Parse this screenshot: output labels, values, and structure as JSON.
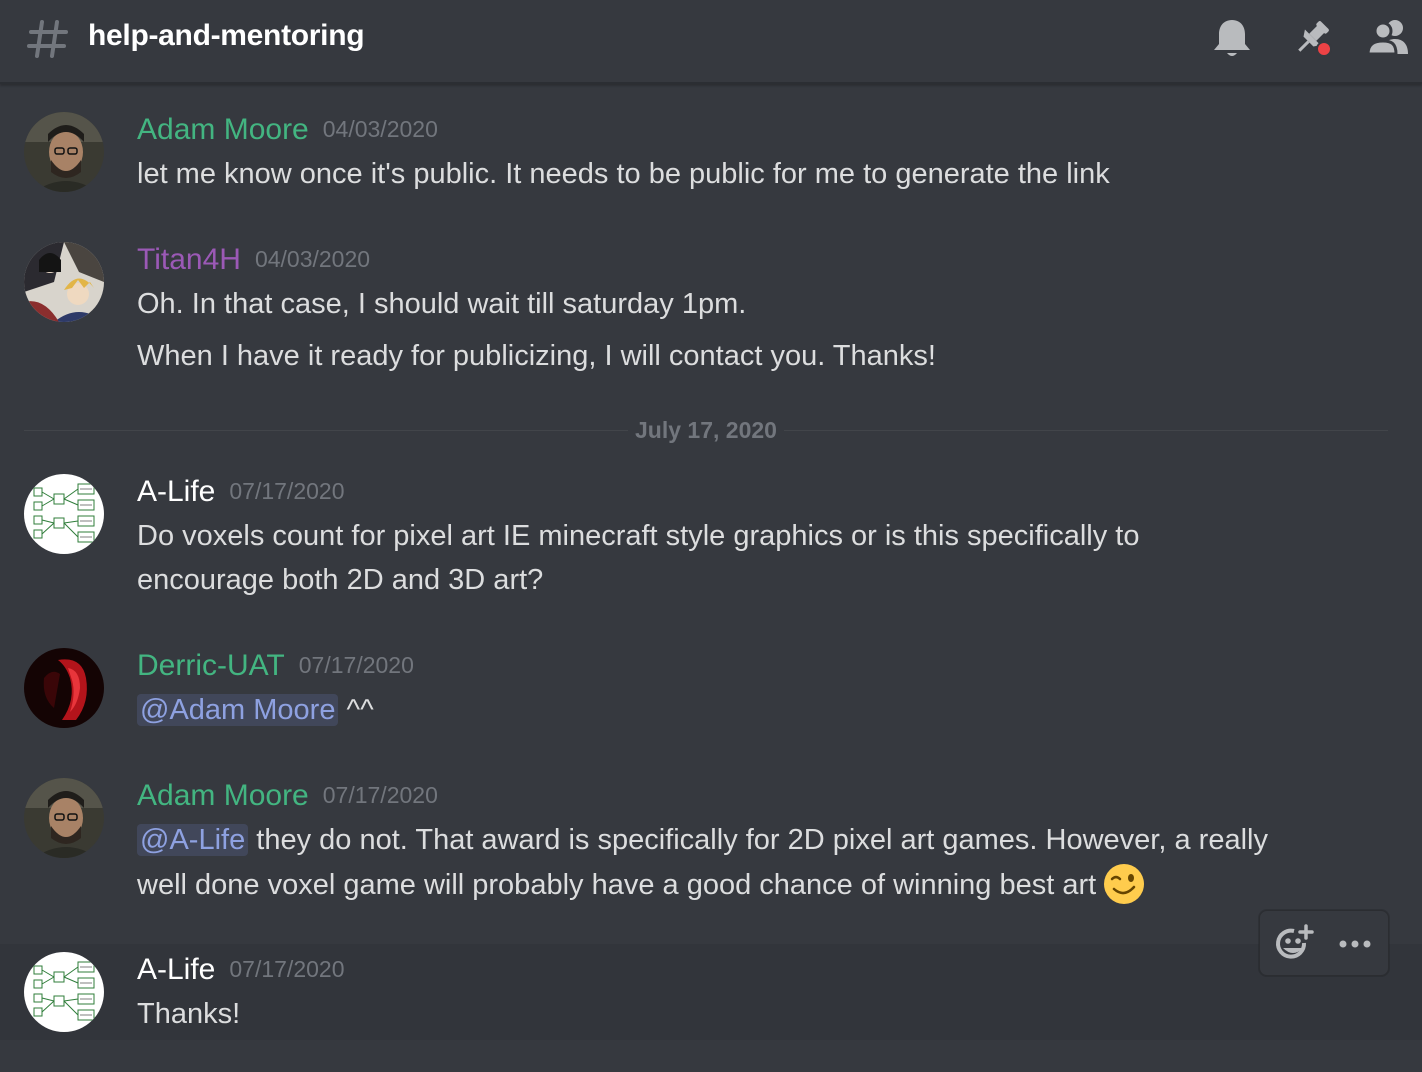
{
  "header": {
    "channel_name": "help-and-mentoring",
    "icons": [
      "hash-icon",
      "bell-icon",
      "pin-icon",
      "members-icon"
    ],
    "pin_notification_color": "#ed4245"
  },
  "colors": {
    "background": "#36393f",
    "adam_moore": "#43b581",
    "titan4h": "#9b59b6",
    "a_life": "#ffffff",
    "derric_uat": "#43b581",
    "mention": "#8ea1e1",
    "timestamp": "#72767d"
  },
  "messages": [
    {
      "author": "Adam Moore",
      "timestamp": "04/03/2020",
      "lines": [
        "let me know once it's public. It needs to be public for me to generate the link"
      ]
    },
    {
      "author": "Titan4H",
      "timestamp": "04/03/2020",
      "lines": [
        "Oh. In that case, I should wait till saturday 1pm.",
        "When I have it ready for publicizing, I will contact you. Thanks!"
      ]
    },
    {
      "author": "A-Life",
      "timestamp": "07/17/2020",
      "lines": [
        "Do voxels count for pixel art IE minecraft style graphics or is this specifically to",
        "encourage both 2D and 3D art?"
      ]
    },
    {
      "author": "Derric-UAT",
      "timestamp": "07/17/2020",
      "mention": "@Adam Moore",
      "after_mention": " ^^"
    },
    {
      "author": "Adam Moore",
      "timestamp": "07/17/2020",
      "mention": "@A-Life",
      "after_mention": " they do not. That award is specifically for 2D pixel art games. However, a really",
      "line2": "well done voxel game will probably have a good chance of winning best art",
      "emoji": "winking-face-emoji"
    },
    {
      "author": "A-Life",
      "timestamp": "07/17/2020",
      "lines": [
        "Thanks!"
      ]
    }
  ],
  "date_divider": "July 17, 2020",
  "message_toolbar": {
    "icons": [
      "add-reaction-icon",
      "more-options-icon"
    ]
  }
}
